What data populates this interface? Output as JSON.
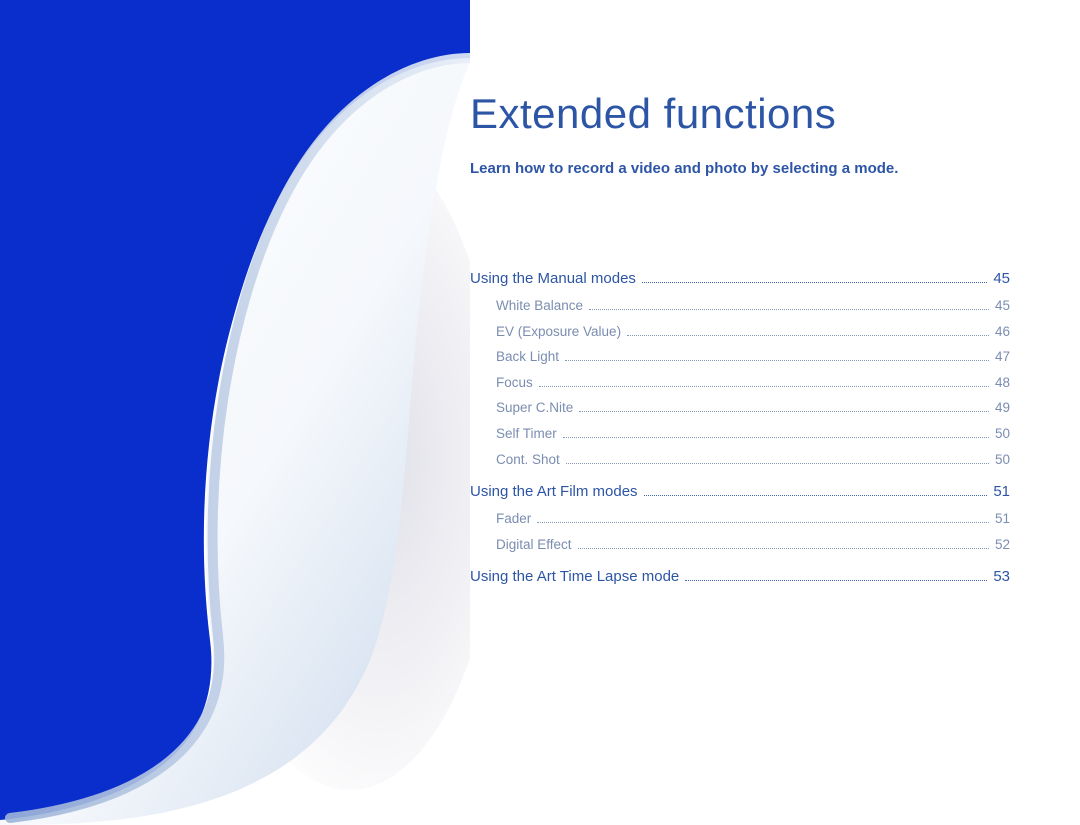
{
  "title": "Extended functions",
  "subtitle": "Learn how to record a video and photo by selecting a mode.",
  "toc": [
    {
      "type": "section",
      "label": "Using the Manual modes",
      "page": "45"
    },
    {
      "type": "sub",
      "label": "White Balance",
      "page": "45"
    },
    {
      "type": "sub",
      "label": "EV (Exposure Value)",
      "page": "46"
    },
    {
      "type": "sub",
      "label": "Back Light",
      "page": "47"
    },
    {
      "type": "sub",
      "label": "Focus",
      "page": "48"
    },
    {
      "type": "sub",
      "label": "Super C.Nite",
      "page": "49"
    },
    {
      "type": "sub",
      "label": "Self Timer",
      "page": "50"
    },
    {
      "type": "sub",
      "label": "Cont. Shot",
      "page": "50"
    },
    {
      "type": "section",
      "label": "Using the Art Film modes",
      "page": "51"
    },
    {
      "type": "sub",
      "label": "Fader",
      "page": "51"
    },
    {
      "type": "sub",
      "label": "Digital Effect",
      "page": "52"
    },
    {
      "type": "section",
      "label": "Using the Art Time Lapse mode",
      "page": "53"
    }
  ]
}
